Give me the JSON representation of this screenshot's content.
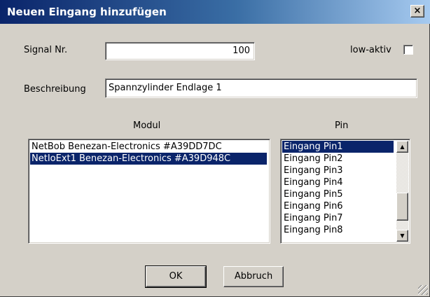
{
  "window": {
    "title": "Neuen Eingang hinzufügen",
    "close_symbol": "×"
  },
  "form": {
    "signal_label": "Signal Nr.",
    "signal_value": "100",
    "low_active_label": "low-aktiv",
    "low_active_checked": false,
    "description_label": "Beschreibung",
    "description_value": "Spannzylinder Endlage 1"
  },
  "modul": {
    "header": "Modul",
    "items": [
      {
        "label": "NetBob Benezan-Electronics #A39DD7DC",
        "selected": false
      },
      {
        "label": "NetIoExt1 Benezan-Electronics #A39D948C",
        "selected": true
      }
    ]
  },
  "pin": {
    "header": "Pin",
    "items": [
      {
        "label": "Eingang Pin1",
        "selected": true
      },
      {
        "label": "Eingang Pin2",
        "selected": false
      },
      {
        "label": "Eingang Pin3",
        "selected": false
      },
      {
        "label": "Eingang Pin4",
        "selected": false
      },
      {
        "label": "Eingang Pin5",
        "selected": false
      },
      {
        "label": "Eingang Pin6",
        "selected": false
      },
      {
        "label": "Eingang Pin7",
        "selected": false
      },
      {
        "label": "Eingang Pin8",
        "selected": false
      }
    ],
    "scroll_up_icon": "▲",
    "scroll_down_icon": "▼"
  },
  "buttons": {
    "ok_label": "OK",
    "cancel_label": "Abbruch"
  },
  "colors": {
    "selection": "#0a246a",
    "title_start": "#0a246a",
    "title_end": "#a6caf0",
    "face": "#d4d0c8"
  }
}
